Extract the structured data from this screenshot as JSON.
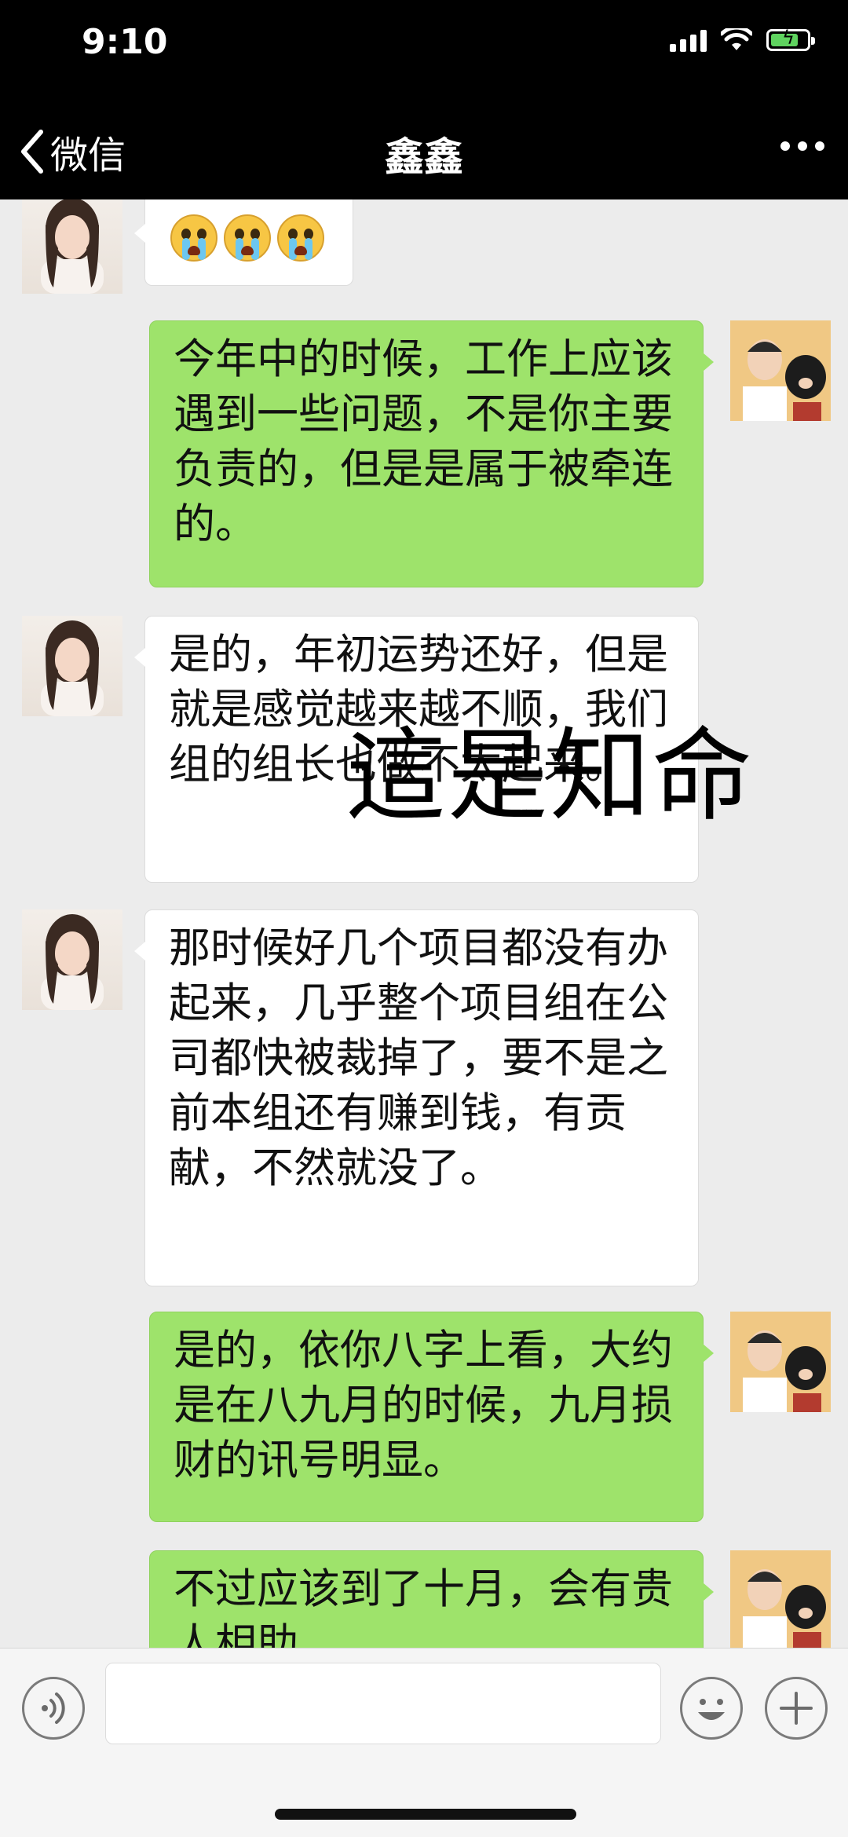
{
  "status_bar": {
    "time": "9:10",
    "icons": [
      "signal-icon",
      "wifi-icon",
      "battery-charging-icon"
    ],
    "battery_color": "#5fd35f"
  },
  "nav": {
    "back_label": "微信",
    "title": "鑫鑫",
    "more_icon": "more-dots-icon"
  },
  "messages": [
    {
      "sender": "contact",
      "type": "emoji",
      "emoji": [
        "loudly-crying-face",
        "loudly-crying-face",
        "loudly-crying-face"
      ]
    },
    {
      "sender": "self",
      "type": "text",
      "text": "今年中的时候，工作上应该遇到一些问题，不是你主要负责的，但是是属于被牵连的。"
    },
    {
      "sender": "contact",
      "type": "text",
      "text": "是的，年初运势还好，但是就是感觉越来越不顺，我们组的组长也做不太起来。"
    },
    {
      "sender": "contact",
      "type": "text",
      "text": "那时候好几个项目都没有办起来，几乎整个项目组在公司都快被裁掉了，要不是之前本组还有赚到钱，有贡献，不然就没了。"
    },
    {
      "sender": "self",
      "type": "text",
      "text": "是的，依你八字上看，大约是在八九月的时候，九月损财的讯号明显。"
    },
    {
      "sender": "self",
      "type": "text",
      "text": "不过应该到了十月，会有贵人相助"
    }
  ],
  "overlay_text": "這是知命",
  "input_bar": {
    "voice_icon": "voice-icon",
    "emoji_icon": "emoji-icon",
    "plus_icon": "plus-icon",
    "input_value": ""
  },
  "colors": {
    "self_bubble": "#9ee36b",
    "contact_bubble": "#ffffff",
    "chat_background": "#ececec",
    "header_background": "#000000"
  }
}
